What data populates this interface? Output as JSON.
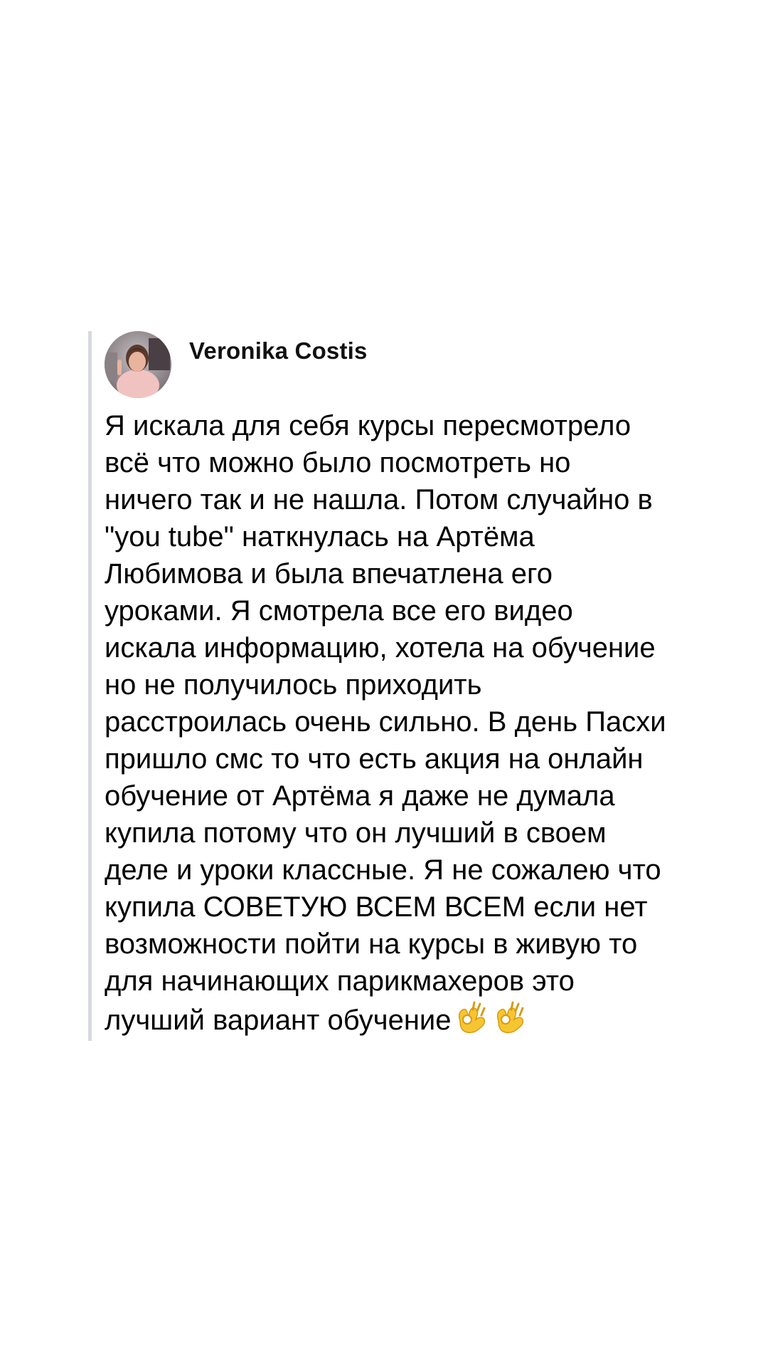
{
  "post": {
    "author_name": "Veronika Costis",
    "avatar_icon": "user-avatar-photo",
    "accent_border_color": "#d6d9e0",
    "text_lines": [
      "Я искала для себя курсы пересмотрело",
      "всё что можно было посмотреть но",
      "ничего так и не нашла. Потом случайно в",
      "\"you tube\" наткнулась на Артёма",
      "Любимова и была впечатлена его",
      "уроками. Я смотрела все его видео",
      "искала информацию, хотела на обучение",
      "но не получилось приходить",
      "расстроилась очень сильно. В день Пасхи",
      "пришло смс то что есть акция на онлайн",
      "обучение от Артёма я даже не думала",
      "купила потому что он лучший в своем",
      "деле и уроки классные. Я не сожалею что",
      "купила СОВЕТУЮ ВСЕМ ВСЕМ если нет",
      "возможности пойти на курсы в живую то",
      "для начинающих парикмахеров это",
      "лучший вариант обучение"
    ],
    "trailing_emojis": [
      "ok-hand-icon",
      "ok-hand-icon"
    ]
  }
}
